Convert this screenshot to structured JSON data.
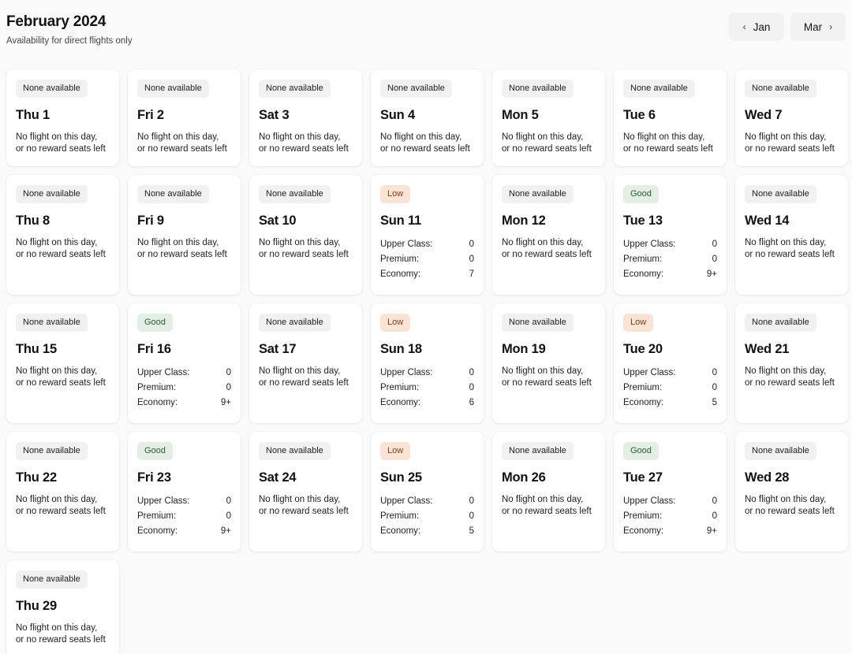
{
  "header": {
    "title": "February 2024",
    "subtitle": "Availability for direct flights only",
    "prev_label": "Jan",
    "next_label": "Mar",
    "prev_chevron": "‹",
    "next_chevron": "›"
  },
  "labels": {
    "none_available": "None available",
    "low": "Low",
    "good": "Good",
    "no_flight_note": "No flight on this day,\nor no reward seats left",
    "upper_class": "Upper Class:",
    "premium": "Premium:",
    "economy": "Economy:"
  },
  "colors": {
    "page_background": "#fafafa",
    "card_background": "#ffffff",
    "badge_none_bg": "#f1f1f1",
    "badge_low_bg": "#fbe4d5",
    "badge_low_text": "#7a3c18",
    "badge_good_bg": "#e3eee5",
    "badge_good_text": "#2c5a37",
    "nav_button_bg": "#f2f2f2",
    "text_primary": "#121212"
  },
  "days": [
    {
      "day": "Thu 1",
      "status": "none",
      "badge": "None available",
      "note": "No flight on this day,\nor no reward seats left",
      "seats": null
    },
    {
      "day": "Fri 2",
      "status": "none",
      "badge": "None available",
      "note": "No flight on this day,\nor no reward seats left",
      "seats": null
    },
    {
      "day": "Sat 3",
      "status": "none",
      "badge": "None available",
      "note": "No flight on this day,\nor no reward seats left",
      "seats": null
    },
    {
      "day": "Sun 4",
      "status": "none",
      "badge": "None available",
      "note": "No flight on this day,\nor no reward seats left",
      "seats": null
    },
    {
      "day": "Mon 5",
      "status": "none",
      "badge": "None available",
      "note": "No flight on this day,\nor no reward seats left",
      "seats": null
    },
    {
      "day": "Tue 6",
      "status": "none",
      "badge": "None available",
      "note": "No flight on this day,\nor no reward seats left",
      "seats": null
    },
    {
      "day": "Wed 7",
      "status": "none",
      "badge": "None available",
      "note": "No flight on this day,\nor no reward seats left",
      "seats": null
    },
    {
      "day": "Thu 8",
      "status": "none",
      "badge": "None available",
      "note": "No flight on this day,\nor no reward seats left",
      "seats": null
    },
    {
      "day": "Fri 9",
      "status": "none",
      "badge": "None available",
      "note": "No flight on this day,\nor no reward seats left",
      "seats": null
    },
    {
      "day": "Sat 10",
      "status": "none",
      "badge": "None available",
      "note": "No flight on this day,\nor no reward seats left",
      "seats": null
    },
    {
      "day": "Sun 11",
      "status": "low",
      "badge": "Low",
      "note": null,
      "seats": {
        "upper_class": "0",
        "premium": "0",
        "economy": "7"
      }
    },
    {
      "day": "Mon 12",
      "status": "none",
      "badge": "None available",
      "note": "No flight on this day,\nor no reward seats left",
      "seats": null
    },
    {
      "day": "Tue 13",
      "status": "good",
      "badge": "Good",
      "note": null,
      "seats": {
        "upper_class": "0",
        "premium": "0",
        "economy": "9+"
      }
    },
    {
      "day": "Wed 14",
      "status": "none",
      "badge": "None available",
      "note": "No flight on this day,\nor no reward seats left",
      "seats": null
    },
    {
      "day": "Thu 15",
      "status": "none",
      "badge": "None available",
      "note": "No flight on this day,\nor no reward seats left",
      "seats": null
    },
    {
      "day": "Fri 16",
      "status": "good",
      "badge": "Good",
      "note": null,
      "seats": {
        "upper_class": "0",
        "premium": "0",
        "economy": "9+"
      }
    },
    {
      "day": "Sat 17",
      "status": "none",
      "badge": "None available",
      "note": "No flight on this day,\nor no reward seats left",
      "seats": null
    },
    {
      "day": "Sun 18",
      "status": "low",
      "badge": "Low",
      "note": null,
      "seats": {
        "upper_class": "0",
        "premium": "0",
        "economy": "6"
      }
    },
    {
      "day": "Mon 19",
      "status": "none",
      "badge": "None available",
      "note": "No flight on this day,\nor no reward seats left",
      "seats": null
    },
    {
      "day": "Tue 20",
      "status": "low",
      "badge": "Low",
      "note": null,
      "seats": {
        "upper_class": "0",
        "premium": "0",
        "economy": "5"
      }
    },
    {
      "day": "Wed 21",
      "status": "none",
      "badge": "None available",
      "note": "No flight on this day,\nor no reward seats left",
      "seats": null
    },
    {
      "day": "Thu 22",
      "status": "none",
      "badge": "None available",
      "note": "No flight on this day,\nor no reward seats left",
      "seats": null
    },
    {
      "day": "Fri 23",
      "status": "good",
      "badge": "Good",
      "note": null,
      "seats": {
        "upper_class": "0",
        "premium": "0",
        "economy": "9+"
      }
    },
    {
      "day": "Sat 24",
      "status": "none",
      "badge": "None available",
      "note": "No flight on this day,\nor no reward seats left",
      "seats": null
    },
    {
      "day": "Sun 25",
      "status": "low",
      "badge": "Low",
      "note": null,
      "seats": {
        "upper_class": "0",
        "premium": "0",
        "economy": "5"
      }
    },
    {
      "day": "Mon 26",
      "status": "none",
      "badge": "None available",
      "note": "No flight on this day,\nor no reward seats left",
      "seats": null
    },
    {
      "day": "Tue 27",
      "status": "good",
      "badge": "Good",
      "note": null,
      "seats": {
        "upper_class": "0",
        "premium": "0",
        "economy": "9+"
      }
    },
    {
      "day": "Wed 28",
      "status": "none",
      "badge": "None available",
      "note": "No flight on this day,\nor no reward seats left",
      "seats": null
    },
    {
      "day": "Thu 29",
      "status": "none",
      "badge": "None available",
      "note": "No flight on this day,\nor no reward seats left",
      "seats": null
    }
  ]
}
